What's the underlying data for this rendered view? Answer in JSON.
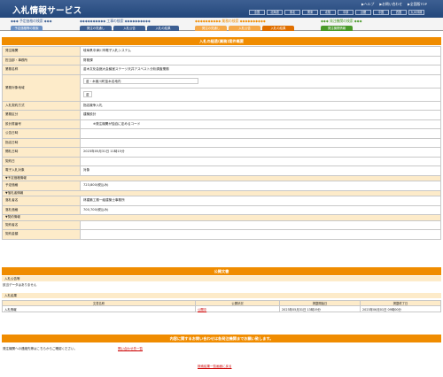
{
  "header": {
    "logo": "入札情報サービス",
    "top_links": [
      "▶ヘルプ",
      "▶お問い合わせ",
      "▶全国版TOP"
    ],
    "regions": [
      "全国",
      "北海道",
      "東北",
      "関東",
      "北陸",
      "中部",
      "近畿",
      "中国",
      "四国",
      "九州沖縄"
    ]
  },
  "nav": [
    {
      "title": "◆◆◆ 予定価格の検索 ◆◆◆",
      "tabs": [
        "予定価格等の検索"
      ],
      "color": "#6a8fc2"
    },
    {
      "title": "◆◆◆◆◆◆◆◆◆◆ 工事の検索 ◆◆◆◆◆◆◆◆◆◆",
      "tabs": [
        "発注の見通し",
        "入札公告",
        "入札の結果"
      ],
      "color": "#3d5f92"
    },
    {
      "title": "◆◆◆◆◆◆◆◆◆◆ 業務の検索 ◆◆◆◆◆◆◆◆◆◆",
      "tabs": [
        "発注の見通し",
        "入札公告",
        "入札の結果"
      ],
      "color": "#f08c00"
    },
    {
      "title": "◆◆◆ 発注機関の検索 ◆◆◆",
      "tabs": [
        "発注機関情報"
      ],
      "color": "#4a9a2a"
    }
  ],
  "detail": {
    "title": "入札の経過(業務)案件概要",
    "rows": [
      {
        "label": "発注機関",
        "value": "岐阜県中津川市電子入札システム"
      },
      {
        "label": "担当部・事務所",
        "value": "財務課"
      },
      {
        "label": "業務名称",
        "value": "苗木文化会館大会議室ステージ天井アスベスト分析調査業務"
      },
      {
        "label": "業務対象地域",
        "value": "苗・木曽川町苗木名地内"
      },
      {
        "label": "",
        "value": "苗"
      },
      {
        "label": "入札契約方式",
        "value": "指名競争入札"
      },
      {
        "label": "業務区分",
        "value": "建築設計"
      },
      {
        "label": "設計書番号",
        "value": "※発注機関が独自に定めるコード"
      },
      {
        "label": "公告日時",
        "value": ""
      },
      {
        "label": "指名日時",
        "value": ""
      },
      {
        "label": "開札日時",
        "value": "2023年05月31日 11時15分"
      },
      {
        "label": "契約日",
        "value": ""
      },
      {
        "label": "電子入札対象",
        "value": "対象"
      }
    ],
    "sec_estimate": "▼予定価格情報",
    "estimate_label": "予定価格",
    "estimate_value": "723,800(税込み)",
    "sec_award": "▼落札者情報",
    "award_rows": [
      {
        "label": "落札者名",
        "value": "林建築工務一級建築士事務所"
      },
      {
        "label": "落札価格",
        "value": "700,700(税込み)"
      }
    ],
    "sec_contract": "▼契約情報",
    "contract_rows": [
      {
        "label": "契約者名",
        "value": ""
      },
      {
        "label": "契約金額",
        "value": ""
      }
    ]
  },
  "public_docs": {
    "title": "公開文書",
    "notice_header": "入札公告等",
    "notice_empty": "該当データはありません",
    "result_header": "入札結果",
    "columns": [
      "文書名称",
      "公開状況",
      "掲載開始日",
      "掲載終了日"
    ],
    "rows": [
      {
        "name": "入札情報",
        "status": "公開中",
        "start": "2023年05月31日 13時19分",
        "end": "2023年06月01日 09時00分"
      }
    ]
  },
  "inquiry": {
    "bar": "内容に関するお問い合わせは各発注機関までお願い致します。",
    "text": "発注機関への連絡先等はこちらからご確認ください。",
    "link": "問い合わせ先一覧"
  },
  "back_link": "検索結果一覧画面に戻る"
}
